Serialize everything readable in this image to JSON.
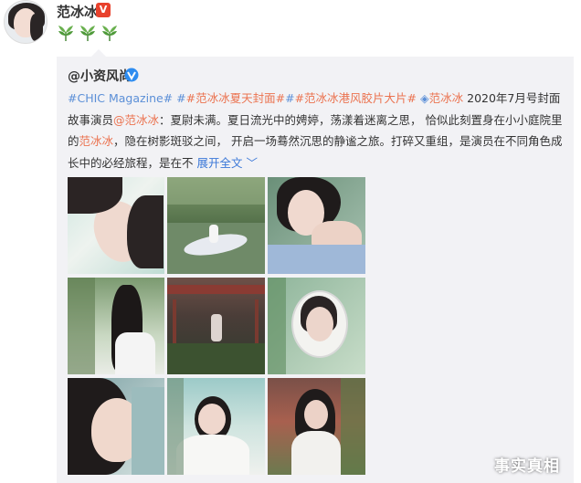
{
  "poster": {
    "name": "范冰冰",
    "vip_badge": "V"
  },
  "repost": {
    "source_user": "@小资风尚",
    "hashtag1": "#CHIC Magazine#",
    "hashtag2": "#范冰冰夏天封面#",
    "hashtag3": "#范冰冰港风胶片大片#",
    "mention_chip": "范冰冰",
    "text_a": " 2020年7月号封面故事演员",
    "mention": "@范冰冰",
    "text_b": "：夏尉未满。夏日流光中的娉婷，荡漾着迷离之思，  恰似此刻置身在小小庭院里的",
    "inline_name": "范冰冰",
    "text_c": "，隐在树影斑驳之间，  开启一场蓦然沉思的静谧之旅。打碎又重组，是演员在不同角色成长中的必经旅程，是在不",
    "expand": "展开全文"
  },
  "watermark": "事实真相"
}
